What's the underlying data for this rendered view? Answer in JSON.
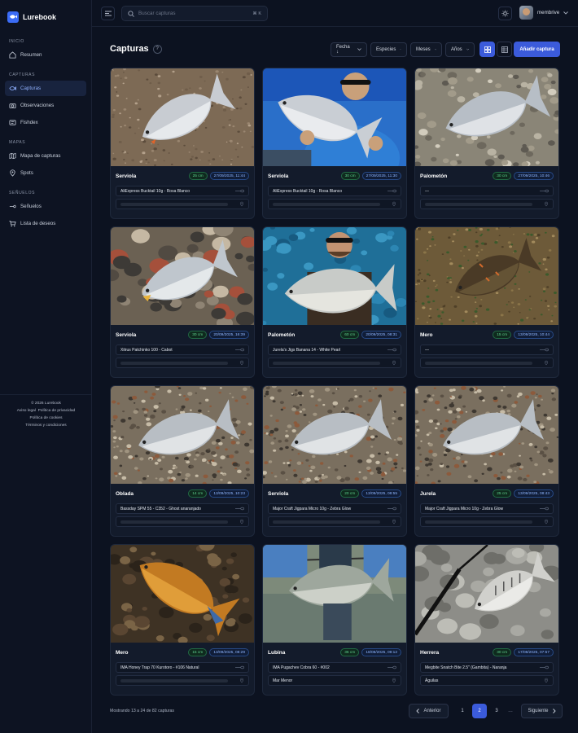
{
  "app": {
    "name": "Lurebook"
  },
  "sidebar": {
    "sections": [
      {
        "title": "INICIO",
        "items": [
          {
            "label": "Resumen",
            "icon": "home-icon"
          }
        ]
      },
      {
        "title": "CAPTURAS",
        "items": [
          {
            "label": "Capturas",
            "icon": "fish-icon",
            "active": true
          },
          {
            "label": "Observaciones",
            "icon": "camera-icon"
          },
          {
            "label": "Fishdex",
            "icon": "id-card-icon"
          }
        ]
      },
      {
        "title": "MAPAS",
        "items": [
          {
            "label": "Mapa de capturas",
            "icon": "map-icon"
          },
          {
            "label": "Spots",
            "icon": "pin-icon"
          }
        ]
      },
      {
        "title": "SEÑUELOS",
        "items": [
          {
            "label": "Señuelos",
            "icon": "lure-icon"
          },
          {
            "label": "Lista de deseos",
            "icon": "cart-icon"
          }
        ]
      }
    ],
    "footer": {
      "copyright": "© 2026 Lurebook",
      "legal": "Aviso legal",
      "privacy": "Política de privacidad",
      "cookies": "Política de cookies",
      "terms": "Términos y condiciones"
    }
  },
  "topbar": {
    "search_placeholder": "Buscar capturas",
    "search_shortcut": "⌘ K",
    "username": "membrive"
  },
  "main": {
    "title": "Capturas",
    "help": "?",
    "filters": [
      "Fecha ↓",
      "Especies",
      "Meses",
      "Años"
    ],
    "add_button": "Añadir captura"
  },
  "captures": [
    {
      "species": "Serviola",
      "size": "25 cm",
      "date": "27/09/2025, 11:44",
      "lure": "AliExpress Bucktail 10g - Rosa Blanco",
      "location": "",
      "photo": "sand"
    },
    {
      "species": "Serviola",
      "size": "30 cm",
      "date": "27/09/2025, 11:30",
      "lure": "AliExpress Bucktail 10g - Rosa Blanco",
      "location": "",
      "photo": "angler-blue"
    },
    {
      "species": "Palometón",
      "size": "30 cm",
      "date": "27/09/2025, 10:46",
      "lure": "—",
      "location": "",
      "photo": "pebbles"
    },
    {
      "species": "Serviola",
      "size": "30 cm",
      "date": "20/09/2025, 16:39",
      "lure": "Xitrus Patchinko 100 - Cabot",
      "location": "",
      "photo": "rocks"
    },
    {
      "species": "Palometón",
      "size": "60 cm",
      "date": "20/09/2025, 08:31",
      "lure": "Jurela's Jigs Banana 14 - White Pearl",
      "location": "",
      "photo": "angler-sea"
    },
    {
      "species": "Mero",
      "size": "15 cm",
      "date": "13/09/2025, 10:44",
      "lure": "—",
      "location": "",
      "photo": "grass"
    },
    {
      "species": "Oblada",
      "size": "14 cm",
      "date": "13/09/2025, 10:23",
      "lure": "Bassday SPM 55 - C352 - Ghost anaranjado",
      "location": "",
      "photo": "gravel"
    },
    {
      "species": "Serviola",
      "size": "20 cm",
      "date": "13/09/2025, 08:55",
      "lure": "Major Craft Jigpara Micro 10g - Zebra Glow",
      "location": "",
      "photo": "gravel"
    },
    {
      "species": "Jurela",
      "size": "25 cm",
      "date": "13/09/2025, 08:43",
      "lure": "Major Craft Jigpara Micro 10g - Zebra Glow",
      "location": "",
      "photo": "gravel"
    },
    {
      "species": "Mero",
      "size": "15 cm",
      "date": "13/09/2025, 08:29",
      "lure": "IMA Honey Trap 70 Kurotoro - #106 Natural",
      "location": "",
      "photo": "gold"
    },
    {
      "species": "Lubina",
      "size": "36 cm",
      "date": "18/08/2025, 09:12",
      "lure": "IMA Pugachev Cobra 60 - #002",
      "location": "Mar Menor",
      "photo": "angler-water"
    },
    {
      "species": "Herrera",
      "size": "30 cm",
      "date": "17/08/2025, 07:57",
      "lure": "Megbite Snatch Bite 2.5\" (Gambita) - Naranja",
      "location": "Águilas",
      "photo": "rock-rod"
    }
  ],
  "pagination": {
    "summary": "Mostrando 13 a 24 de 82 capturas",
    "prev": "Anterior",
    "next": "Siguiente",
    "pages": [
      "1",
      "2",
      "3",
      "…"
    ],
    "current": "2"
  }
}
